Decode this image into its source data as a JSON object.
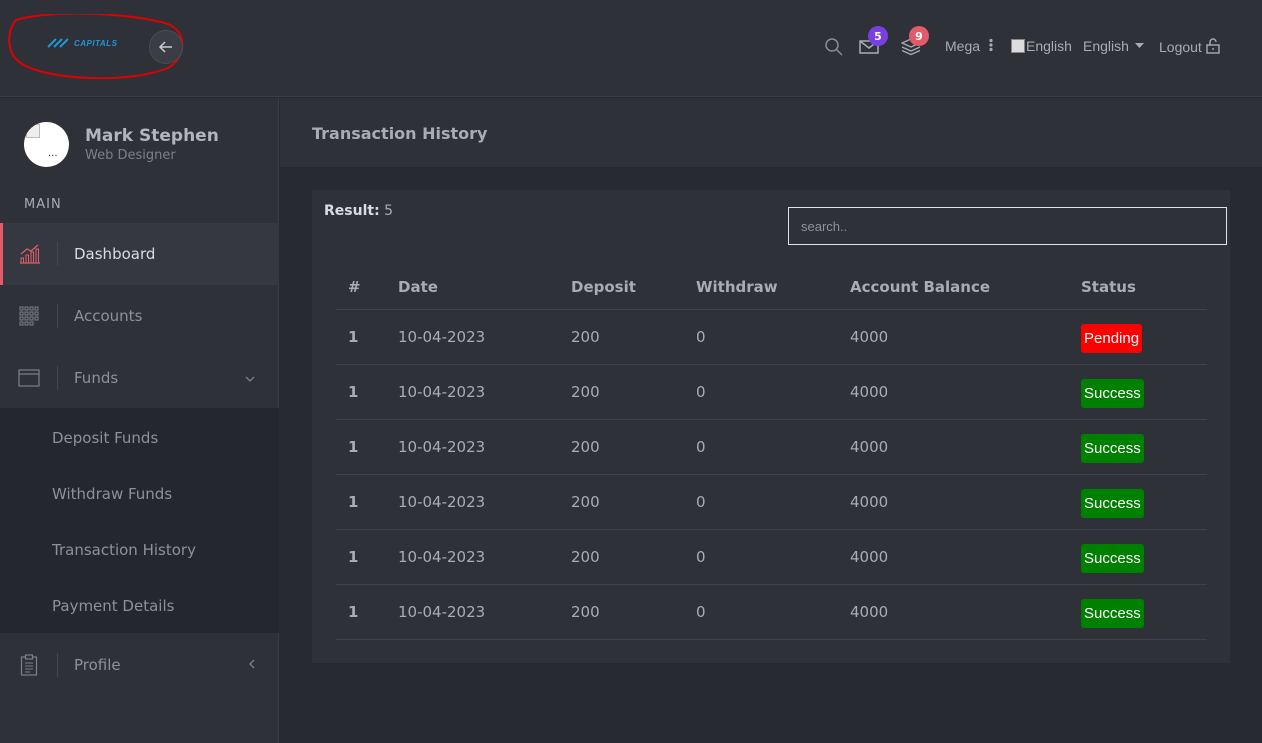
{
  "header": {
    "logo_text": "CAPITALS",
    "mail_badge": "5",
    "layers_badge": "9",
    "mega_label": "Mega",
    "flag_alt": "English",
    "language_label": "English",
    "logout_label": "Logout",
    "colors": {
      "mail_badge": "#7a3fe0",
      "layers_badge": "#e25b6a",
      "annotation": "#e00000"
    }
  },
  "sidebar": {
    "user_name": "Mark Stephen",
    "user_role": "Web Designer",
    "section": "MAIN",
    "items": [
      {
        "label": "Dashboard",
        "icon": "chart-icon"
      },
      {
        "label": "Accounts",
        "icon": "grid-icon"
      },
      {
        "label": "Funds",
        "icon": "window-icon"
      },
      {
        "label": "Profile",
        "icon": "clipboard-icon"
      }
    ],
    "submenu": [
      "Deposit Funds",
      "Withdraw Funds",
      "Transaction History",
      "Payment Details"
    ]
  },
  "page": {
    "title": "Transaction History",
    "result_label": "Result:",
    "result_value": "5",
    "search_placeholder": "search.."
  },
  "table": {
    "headers": [
      "#",
      "Date",
      "Deposit",
      "Withdraw",
      "Account Balance",
      "Status"
    ],
    "rows": [
      {
        "idx": "1",
        "date": "10-04-2023",
        "deposit": "200",
        "withdraw": "0",
        "balance": "4000",
        "status": "Pending"
      },
      {
        "idx": "1",
        "date": "10-04-2023",
        "deposit": "200",
        "withdraw": "0",
        "balance": "4000",
        "status": "Success"
      },
      {
        "idx": "1",
        "date": "10-04-2023",
        "deposit": "200",
        "withdraw": "0",
        "balance": "4000",
        "status": "Success"
      },
      {
        "idx": "1",
        "date": "10-04-2023",
        "deposit": "200",
        "withdraw": "0",
        "balance": "4000",
        "status": "Success"
      },
      {
        "idx": "1",
        "date": "10-04-2023",
        "deposit": "200",
        "withdraw": "0",
        "balance": "4000",
        "status": "Success"
      },
      {
        "idx": "1",
        "date": "10-04-2023",
        "deposit": "200",
        "withdraw": "0",
        "balance": "4000",
        "status": "Success"
      }
    ],
    "status_colors": {
      "Pending": "#ff0000",
      "Success": "#008000"
    }
  }
}
